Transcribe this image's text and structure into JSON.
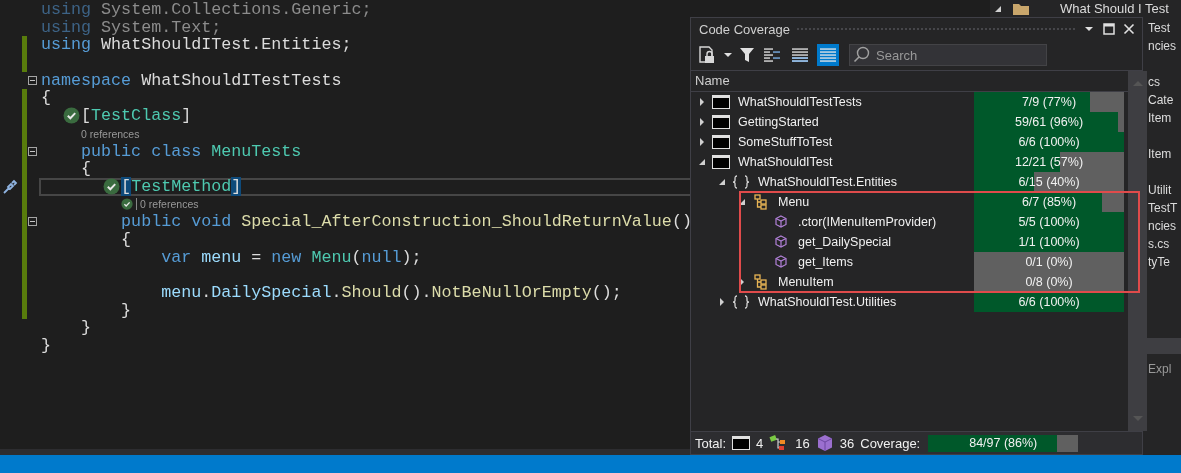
{
  "editor": {
    "lines": [
      {
        "kind": "code",
        "changed": false,
        "fold": false,
        "tokens": [
          {
            "kind": "kw-faded",
            "text": "using"
          },
          {
            "kind": "text-faded",
            "text": " System.Collections.Generic;"
          }
        ]
      },
      {
        "kind": "code",
        "changed": false,
        "fold": false,
        "tokens": [
          {
            "kind": "kw-faded",
            "text": "using"
          },
          {
            "kind": "text-faded",
            "text": " System.Text;"
          }
        ]
      },
      {
        "kind": "code",
        "changed": true,
        "fold": false,
        "tokens": [
          {
            "kind": "kw",
            "text": "using"
          },
          {
            "kind": "plain",
            "text": " WhatShouldITest.Entities;"
          }
        ]
      },
      {
        "kind": "blank",
        "changed": true
      },
      {
        "kind": "code",
        "changed": false,
        "fold": true,
        "tokens": [
          {
            "kind": "kw",
            "text": "namespace"
          },
          {
            "kind": "plain",
            "text": " WhatShouldITestTests"
          }
        ]
      },
      {
        "kind": "code",
        "changed": true,
        "fold": false,
        "tokens": [
          {
            "kind": "plain",
            "text": "{"
          }
        ]
      },
      {
        "kind": "code",
        "changed": true,
        "fold": false,
        "test_passed": true,
        "tokens": [
          {
            "kind": "plain",
            "text": "    ["
          },
          {
            "kind": "type",
            "text": "TestClass"
          },
          {
            "kind": "plain",
            "text": "]"
          }
        ]
      },
      {
        "kind": "codelens",
        "changed": true,
        "test_passed": false,
        "text": "0 references"
      },
      {
        "kind": "code",
        "changed": true,
        "fold": true,
        "tokens": [
          {
            "kind": "kw",
            "text": "    public class"
          },
          {
            "kind": "type",
            "text": " MenuTests"
          }
        ]
      },
      {
        "kind": "code",
        "changed": true,
        "fold": false,
        "tokens": [
          {
            "kind": "plain",
            "text": "    {"
          }
        ]
      },
      {
        "kind": "code",
        "changed": true,
        "fold": false,
        "test_passed": true,
        "current": true,
        "tokens": [
          {
            "kind": "bracket-match",
            "text": "        ["
          },
          {
            "kind": "type",
            "text": "TestMethod"
          },
          {
            "kind": "bracket-match",
            "text": "]"
          }
        ]
      },
      {
        "kind": "codelens",
        "changed": true,
        "test_passed": true,
        "text": "0 references"
      },
      {
        "kind": "code",
        "changed": true,
        "fold": true,
        "tokens": [
          {
            "kind": "kw",
            "text": "        public void"
          },
          {
            "kind": "method",
            "text": " Special_AfterConstruction_ShouldReturnValue"
          },
          {
            "kind": "plain",
            "text": "()"
          }
        ]
      },
      {
        "kind": "code",
        "changed": true,
        "fold": false,
        "tokens": [
          {
            "kind": "plain",
            "text": "        {"
          }
        ]
      },
      {
        "kind": "code",
        "changed": true,
        "fold": false,
        "tokens": [
          {
            "kind": "kw",
            "text": "            var"
          },
          {
            "kind": "ident",
            "text": " menu"
          },
          {
            "kind": "plain",
            "text": " = "
          },
          {
            "kind": "kw",
            "text": "new"
          },
          {
            "kind": "type",
            "text": " Menu"
          },
          {
            "kind": "plain",
            "text": "("
          },
          {
            "kind": "kw",
            "text": "null"
          },
          {
            "kind": "plain",
            "text": ");"
          }
        ]
      },
      {
        "kind": "blank",
        "changed": true
      },
      {
        "kind": "code",
        "changed": true,
        "fold": false,
        "tokens": [
          {
            "kind": "ident",
            "text": "            menu"
          },
          {
            "kind": "plain",
            "text": "."
          },
          {
            "kind": "ident",
            "text": "DailySpecial"
          },
          {
            "kind": "plain",
            "text": "."
          },
          {
            "kind": "method",
            "text": "Should"
          },
          {
            "kind": "plain",
            "text": "()."
          },
          {
            "kind": "method",
            "text": "NotBeNullOrEmpty"
          },
          {
            "kind": "plain",
            "text": "();"
          }
        ]
      },
      {
        "kind": "code",
        "changed": true,
        "fold": false,
        "tokens": [
          {
            "kind": "plain",
            "text": "        }"
          }
        ]
      },
      {
        "kind": "code",
        "changed": false,
        "fold": false,
        "tokens": [
          {
            "kind": "plain",
            "text": "    }"
          }
        ]
      },
      {
        "kind": "code",
        "changed": false,
        "fold": false,
        "tokens": [
          {
            "kind": "plain",
            "text": "}"
          }
        ]
      }
    ]
  },
  "solution_explorer": {
    "top_item": "What Should I Test",
    "fragments": [
      {
        "text": "Test",
        "gap_before": false
      },
      {
        "text": "ncies",
        "gap_before": false
      },
      {
        "text": "cs",
        "gap_before": true
      },
      {
        "text": "Cate",
        "gap_before": false
      },
      {
        "text": "Item",
        "gap_before": false
      },
      {
        "text": "Item",
        "gap_before": true
      },
      {
        "text": "Utilit",
        "gap_before": true
      },
      {
        "text": "TestT",
        "gap_before": false
      },
      {
        "text": "ncies",
        "gap_before": false
      },
      {
        "text": "s.cs",
        "gap_before": false
      },
      {
        "text": "tyTe",
        "gap_before": false
      }
    ],
    "tab": "Expl"
  },
  "coverage_window": {
    "title": "Code Coverage",
    "layout_buttons": [
      {
        "selected": false
      },
      {
        "selected": false
      },
      {
        "selected": true
      }
    ],
    "search": {
      "placeholder": "Search"
    },
    "columns": [
      "Name"
    ],
    "tree": [
      {
        "kind": "module",
        "name": "WhatShouldITestTests",
        "expanded": false,
        "coverage": "7/9 (77%)",
        "level": 0.77
      },
      {
        "kind": "module",
        "name": "GettingStarted",
        "expanded": false,
        "coverage": "59/61 (96%)",
        "level": 0.96
      },
      {
        "kind": "module",
        "name": "SomeStuffToTest",
        "expanded": false,
        "coverage": "6/6 (100%)",
        "level": 1
      },
      {
        "kind": "module",
        "name": "WhatShouldITest",
        "expanded": true,
        "coverage": "12/21 (57%)",
        "level": 0.57,
        "children": [
          {
            "kind": "namespace",
            "name": "WhatShouldITest.Entities",
            "expanded": true,
            "highlight_children": true,
            "coverage": "6/15 (40%)",
            "level": 0.4,
            "children": [
              {
                "kind": "class",
                "name": "Menu",
                "expanded": true,
                "coverage": "6/7 (85%)",
                "level": 0.85,
                "children": [
                  {
                    "kind": "method",
                    "name": ".ctor(IMenuItemProvider)",
                    "coverage": "5/5 (100%)",
                    "level": 1
                  },
                  {
                    "kind": "method",
                    "name": "get_DailySpecial",
                    "coverage": "1/1 (100%)",
                    "level": 1
                  },
                  {
                    "kind": "method",
                    "name": "get_Items",
                    "coverage": "0/1 (0%)",
                    "level": 0
                  }
                ]
              },
              {
                "kind": "class",
                "name": "MenuItem",
                "expanded": false,
                "coverage": "0/8 (0%)",
                "level": 0
              }
            ]
          },
          {
            "kind": "namespace",
            "name": "WhatShouldITest.Utilities",
            "expanded": false,
            "coverage": "6/6 (100%)",
            "level": 1
          }
        ]
      }
    ],
    "footer": {
      "label": "Total:",
      "modules": "4",
      "classes": "16",
      "methods": "36",
      "coverage_label": "Coverage:",
      "coverage": "84/97 (86%)",
      "level": 0.86
    }
  }
}
